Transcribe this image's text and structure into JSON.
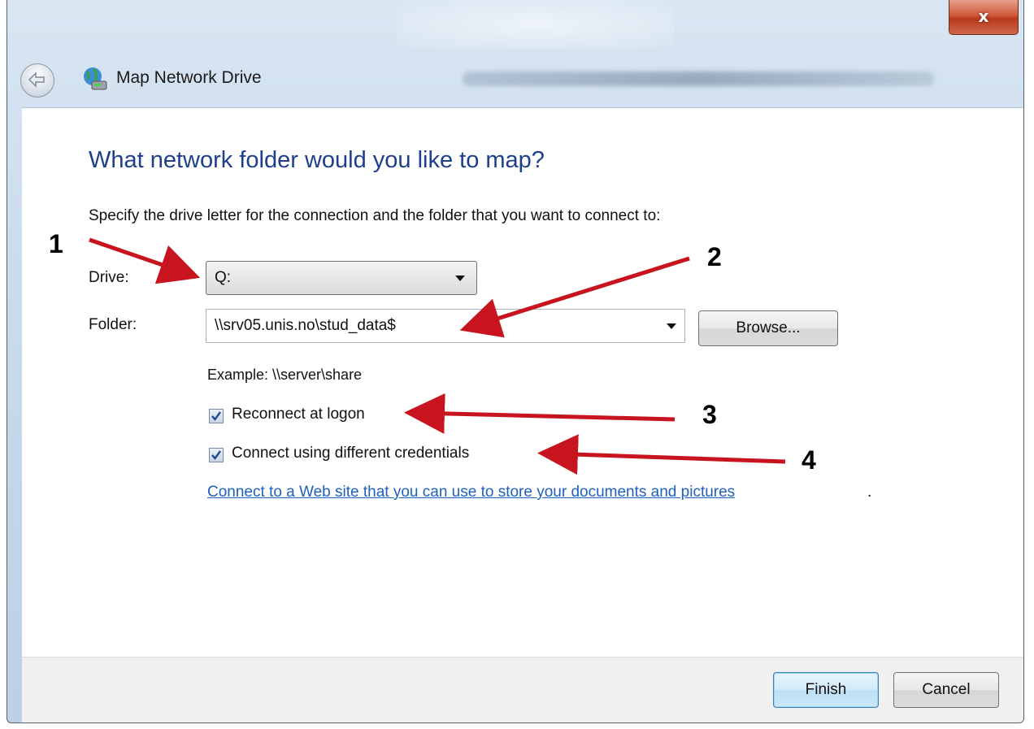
{
  "window": {
    "title": "Map Network Drive",
    "close_glyph": "x"
  },
  "main": {
    "heading": "What network folder would you like to map?",
    "instruction": "Specify the drive letter for the connection and the folder that you want to connect to:",
    "drive_label": "Drive:",
    "drive_value": "Q:",
    "folder_label": "Folder:",
    "folder_value": "\\\\srv05.unis.no\\stud_data$",
    "browse_label": "Browse...",
    "example": "Example: \\\\server\\share",
    "reconnect": {
      "label": "Reconnect at logon",
      "checked": true
    },
    "credentials": {
      "label": "Connect using different credentials",
      "checked": true
    },
    "link_text": "Connect to a Web site that you can use to store your documents and pictures",
    "link_suffix": "."
  },
  "footer": {
    "finish_label": "Finish",
    "cancel_label": "Cancel"
  },
  "annotations": [
    {
      "number": "1",
      "color": "#c8141e"
    },
    {
      "number": "2",
      "color": "#c8141e"
    },
    {
      "number": "3",
      "color": "#c8141e"
    },
    {
      "number": "4",
      "color": "#c8141e"
    }
  ]
}
